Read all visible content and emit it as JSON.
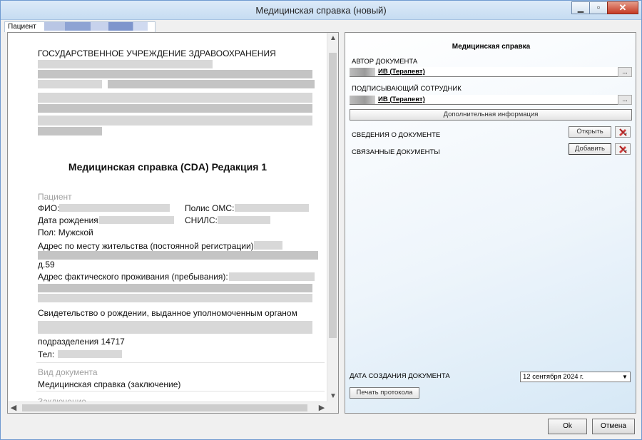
{
  "window": {
    "title": "Медицинская справка (новый)"
  },
  "tabs": [
    {
      "label": "Пациент"
    }
  ],
  "document": {
    "org_line": "ГОСУДАРСТВЕННОЕ УЧРЕЖДЕНИЕ ЗДРАВООХРАНЕНИЯ",
    "title": "Медицинская справка (CDA) Редакция 1",
    "section_patient": "Пациент",
    "fio_label": "ФИО:",
    "oms_label": "Полис ОМС:",
    "birth_label": "Дата рождения:",
    "snils_label": "СНИЛС:",
    "sex_line": "Пол: Мужской",
    "reg_address_label": "Адрес по месту жительства (постоянной регистрации):",
    "reg_address_tail": "д.59",
    "fact_address_label": "Адрес фактического проживания (пребывания):",
    "birth_cert_line": "Свидетельство о рождении, выданное уполномоченным органом",
    "dept_line": "подразделения 14717",
    "phone_label": "Тел:",
    "section_doc_type": "Вид документа",
    "doc_type_value": "Медицинская справка (заключение)",
    "section_conclusion": "Заключение"
  },
  "right": {
    "title": "Медицинская справка",
    "author_label": "АВТОР ДОКУМЕНТА",
    "author_value": "ИВ (Терапевт)",
    "signer_label": "ПОДПИСЫВАЮЩИЙ СОТРУДНИК",
    "signer_value": "ИВ (Терапевт)",
    "picker_glyph": "...",
    "additional_info_button": "Дополнительная информация",
    "doc_info_label": "СВЕДЕНИЯ О ДОКУМЕНТЕ",
    "open_button": "Открыть",
    "related_docs_label": "СВЯЗАННЫЕ ДОКУМЕНТЫ",
    "add_button": "Добавить",
    "created_date_label": "ДАТА СОЗДАНИЯ ДОКУМЕНТА",
    "created_date_value": "12 сентября 2024 г.",
    "print_button": "Печать протокола"
  },
  "footer": {
    "ok_button": "Ok",
    "cancel_button": "Отмена"
  },
  "colors": {
    "accent": "#6f9ad0",
    "close": "#c63a24"
  }
}
